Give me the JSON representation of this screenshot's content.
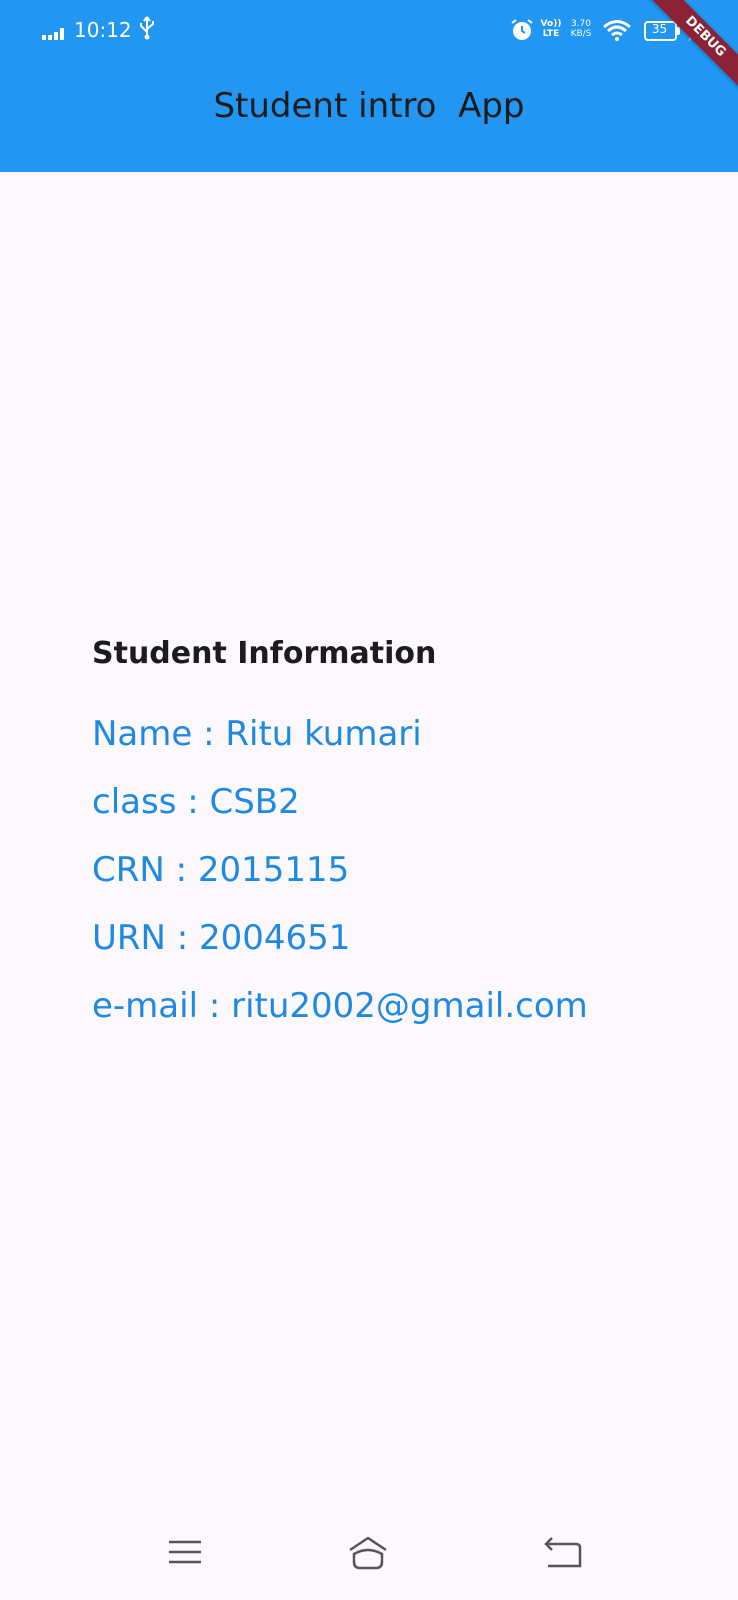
{
  "status_bar": {
    "time": "10:12",
    "volte_line1": "Vo))",
    "volte_line2": "LTE",
    "net_speed_value": "3.70",
    "net_speed_unit": "KB/S",
    "battery_level": "35",
    "icons": [
      "signal-icon",
      "usb-icon",
      "alarm-icon",
      "wifi-icon",
      "battery-icon",
      "charging-icon"
    ]
  },
  "debug_banner": "DEBUG",
  "app_bar": {
    "title": "Student intro  App",
    "color": "#2196f3"
  },
  "student": {
    "heading": "Student Information",
    "name": "Name : Ritu kumari",
    "class": "class : CSB2",
    "crn": "CRN : 2015115",
    "urn": "URN : 2004651",
    "email": "e-mail : ritu2002@gmail.com",
    "text_color": "#1e88e5"
  },
  "nav_bar": {
    "buttons": [
      "menu-icon",
      "home-icon",
      "back-icon"
    ]
  }
}
